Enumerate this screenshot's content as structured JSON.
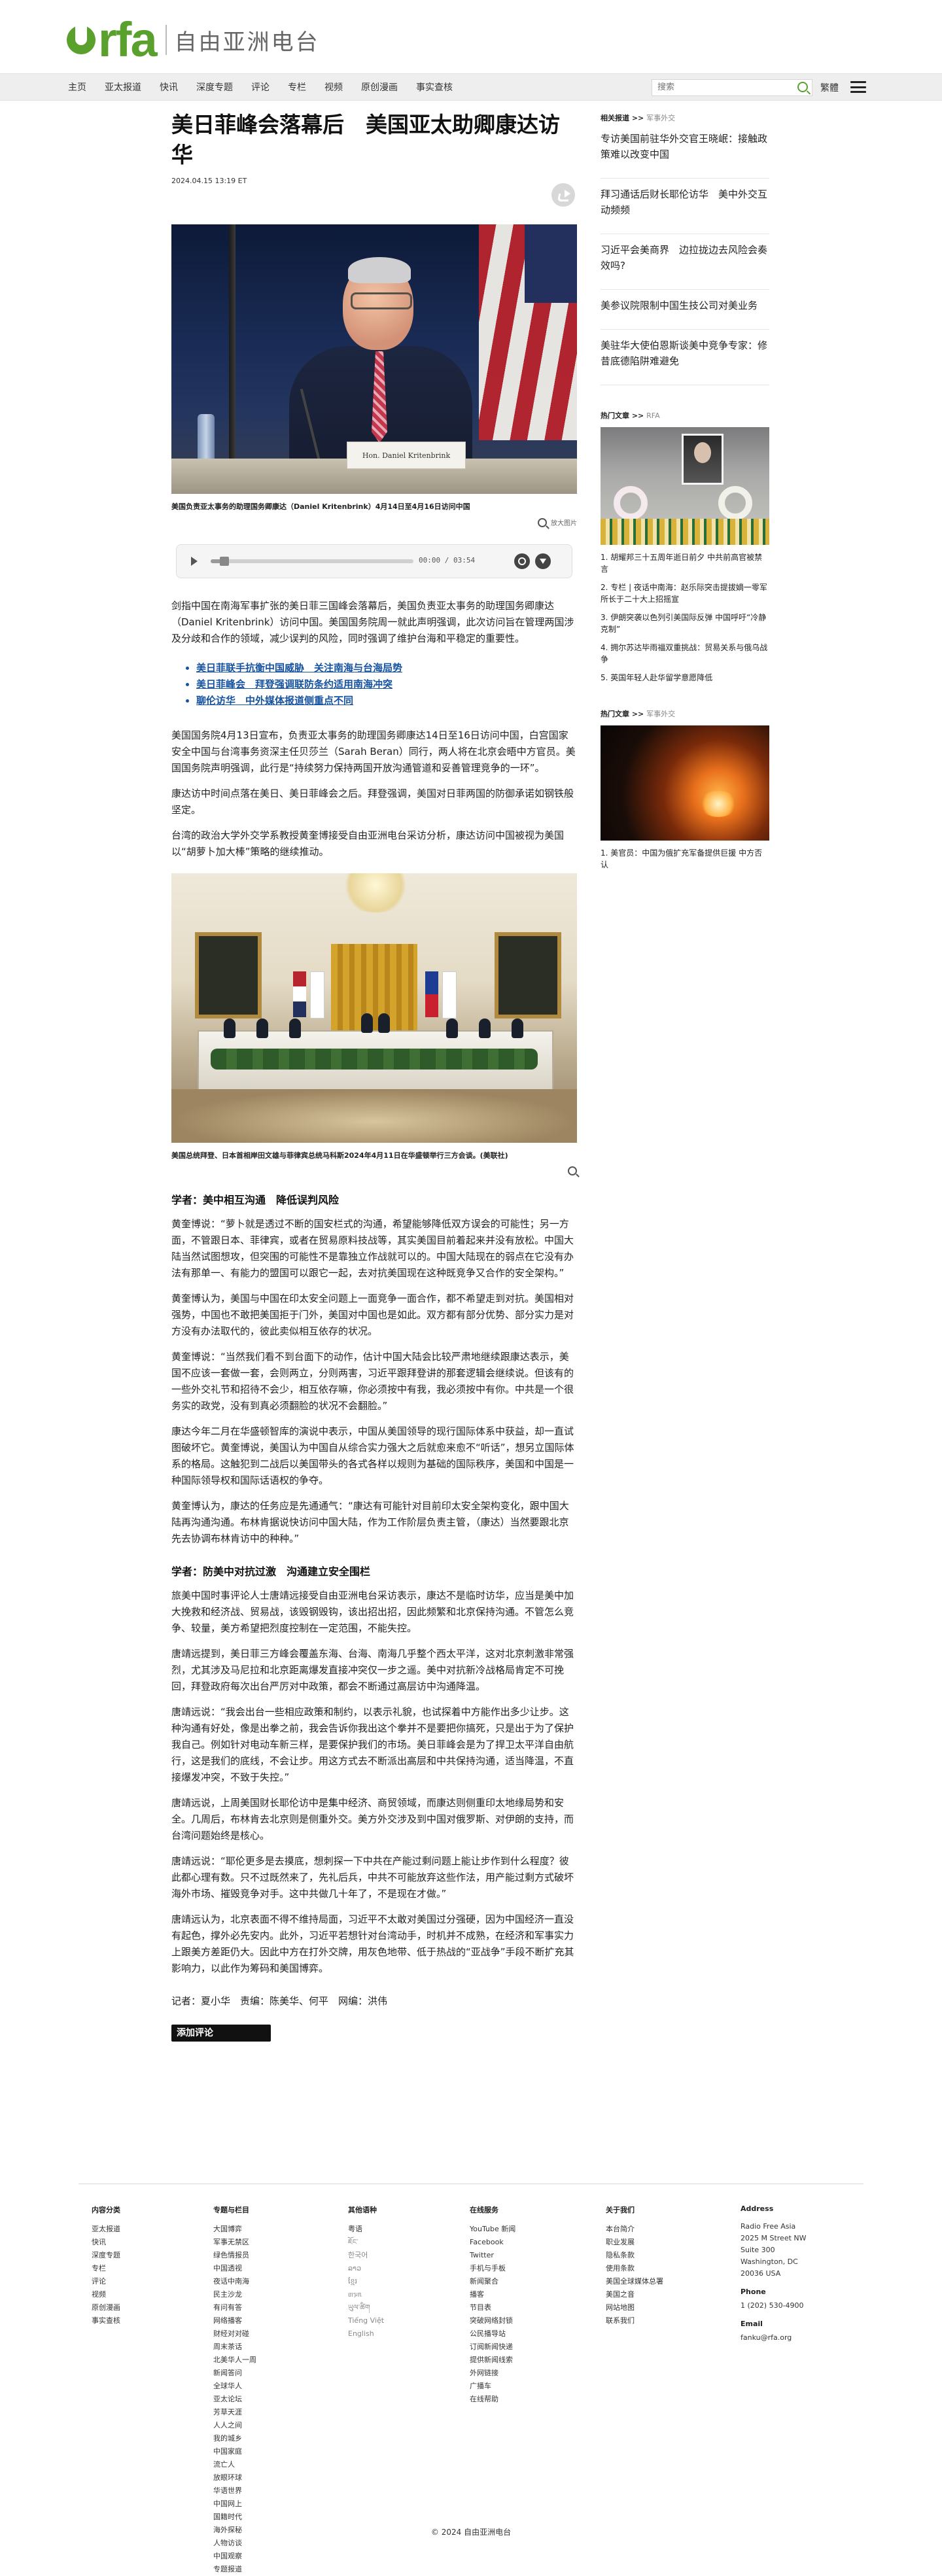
{
  "site": {
    "logo_text": "rfa",
    "name_cn": "自由亚洲电台"
  },
  "nav": {
    "items": [
      "主页",
      "亚太报道",
      "快讯",
      "深度专题",
      "评论",
      "专栏",
      "视频",
      "原创漫画",
      "事实查核"
    ],
    "search_placeholder": "搜索",
    "trad_label": "繁體"
  },
  "article": {
    "headline": "美日菲峰会落幕后　美国亚太助卿康达访华",
    "date": "2024.04.15 13:19 ET",
    "photo1": {
      "nameplate": "Hon. Daniel Kritenbrink",
      "caption": "美国负责亚太事务的助理国务卿康达（Daniel Kritenbrink）4月14日至4月16日访问中国"
    },
    "zoom_label": "放大图片",
    "audio": {
      "time": "00:00 / 03:54",
      "progress": 0.05
    },
    "lede": "剑指中国在南海军事扩张的美日菲三国峰会落幕后，美国负责亚太事务的助理国务卿康达（Daniel Kritenbrink）访问中国。美国国务院周一就此声明强调，此次访问旨在管理两国涉及分歧和合作的领域，减少误判的风险，同时强调了维护台海和平稳定的重要性。",
    "related": [
      "美日菲联手抗衡中国威胁　关注南海与台海局势",
      "美日菲峰会　拜登强调联防条约适用南海冲突",
      "聊伦访华　中外媒体报道侧重点不同"
    ],
    "paragraphs_a": [
      "美国国务院4月13日宣布，负责亚太事务的助理国务卿康达14日至16日访问中国，白宫国家安全中国与台湾事务资深主任贝莎兰（Sarah Beran）同行，两人将在北京会晤中方官员。美国国务院声明强调，此行是“持续努力保持两国开放沟通管道和妥善管理竞争的一环”。",
      "康达访中时间点落在美日、美日菲峰会之后。拜登强调，美国对日菲两国的防御承诺如钢铁般坚定。",
      "台湾的政治大学外交学系教授黄奎博接受自由亚洲电台采访分析，康达访问中国被视为美国以“胡萝卜加大棒”策略的继续推动。"
    ],
    "photo2": {
      "caption": "美国总统拜登、日本首相岸田文雄与菲律宾总统马科斯2024年4月11日在华盛顿举行三方会谈。(美联社)"
    },
    "subhead1": "学者：美中相互沟通　降低误判风险",
    "paragraphs_b": [
      "黄奎博说：“萝卜就是透过不断的国安栏式的沟通，希望能够降低双方误会的可能性；另一方面，不管跟日本、菲律宾，或者在贸易原料技战等，其实美国目前着起来并没有放松。中国大陆当然试图想攻，但突围的可能性不是靠独立作战就可以的。中国大陆现在的弱点在它没有办法有那单一、有能力的盟国可以跟它一起，去对抗美国现在这种既竞争又合作的安全架构。”",
      "黄奎博认为，美国与中国在印太安全问题上一面竞争一面合作，都不希望走到对抗。美国相对强势，中国也不敢把美国拒于门外，美国对中国也是如此。双方都有部分优势、部分实力是对方没有办法取代的，彼此卖似相互依存的状况。",
      "黄奎博说：“当然我们看不到台面下的动作，估计中国大陆会比较严肃地继续跟康达表示，美国不应该一套做一套，会则两立，分则两害，习近平跟拜登讲的那套逻辑会继续说。但该有的一些外交礼节和招待不会少，相互依存嘛，你必须按中有我，我必须按中有你。中共是一个很务实的政党，没有到真必须翻脸的状况不会翻脸。”",
      "康达今年二月在华盛顿智库的演说中表示，中国从美国领导的现行国际体系中获益，却一直试图破坏它。黄奎博说，美国认为中国自从综合实力强大之后就愈来愈不“听话”，想另立国际体系的格局。这触犯到二战后以美国带头的各式各样以规则为基础的国际秩序，美国和中国是一种国际领导权和国际话语权的争夺。",
      "黄奎博认为，康达的任务应是先通通气：“康达有可能针对目前印太安全架构变化，跟中国大陆再沟通沟通。布林肯据说快访问中国大陆，作为工作阶层负责主管，（康达）当然要跟北京先去协调布林肯访中的种种。”"
    ],
    "subhead2": "学者：防美中对抗过激　沟通建立安全围栏",
    "paragraphs_c": [
      "旅美中国时事评论人士唐靖远接受自由亚洲电台采访表示，康达不是临时访华，应当是美中加大挽救和经济战、贸易战，该毁钢毁钩，该出招出招，因此频繁和北京保持沟通。不管怎么竞争、较量，美方希望把烈度控制在一定范围，不能失控。",
      "唐靖远提到，美日菲三方峰会覆盖东海、台海、南海几乎整个西太平洋，这对北京刺激非常强烈，尤其涉及马尼拉和北京距离爆发直接冲突仅一步之遥。美中对抗新冷战格局肯定不可挽回，拜登政府每次出台严厉对中政策，都会不断通过高层访中沟通降温。",
      "唐靖远说：“我会出台一些相应政策和制约，以表示礼貌，也试探着中方能作出多少让步。这种沟通有好处，像是出拳之前，我会告诉你我出这个拳并不是要把你搞死，只是出于为了保护我自己。例如针对电动车新三样，是要保护我们的市场。美日菲峰会是为了捍卫太平洋自由航行，这是我们的底线，不会让步。用这方式去不断派出高层和中共保持沟通，适当降温，不直接爆发冲突，不致于失控。”",
      "唐靖远说，上周美国财长耶伦访中是集中经济、商贸领域，而康达则侧重印太地缘局势和安全。几周后，布林肯去北京则是侧重外交。美方外交涉及到中国对俄罗斯、对伊朗的支持，而台湾问题始终是核心。",
      "唐靖远说：“耶伦更多是去摸底，想刺探一下中共在产能过剩问题上能让步作到什么程度？彼此都心理有数。只不过既然来了，先礼后兵，中共不可能放弃这些作法，用产能过剩方式破坏海外市场、摧毁竞争对手。这中共做几十年了，不是现在才做。”",
      "唐靖远认为，北京表面不得不维持局面，习近平不太敢对美国过分强硬，因为中国经济一直没有起色，撑外必先安内。此外，习近平若想针对台湾动手，时机并不成熟，在经济和军事实力上跟美方差距仍大。因此中方在打外交牌，用灰色地带、低于热战的“亚战争”手段不断扩充其影响力，以此作为筹码和美国博弈。"
    ],
    "credits": "记者：夏小华　责编：陈美华、何平　网编：洪伟",
    "comment_button": "添加评论"
  },
  "sidebar": {
    "related": {
      "label": "相关报道",
      "category": "军事外交",
      "stories": [
        "专访美国前驻华外交官王晓岷：接触政策难以改变中国",
        "拜习通话后财长耶伦访华　美中外交互动频频",
        "习近平会美商界　边拉拢边去风险会奏效吗?",
        "美参议院限制中国生技公司对美业务",
        "美驻华大使伯恩斯谈美中竞争专家：修昔底德陷阱难避免"
      ]
    },
    "hot1": {
      "label": "热门文章",
      "category": "RFA",
      "items": [
        "1. 胡耀邦三十五周年逝日前夕 中共前高官被禁言",
        "2. 专栏 | 夜话中南海：赵乐际突击提拔嫡一零军所长于二十大上招摇宣",
        "3. 伊朗突袭以色列引美国际反弹 中国呼吁“冷静克制”",
        "4. 拥尔苏达毕雨福双重挑战：贸易关系与俄乌战争",
        "5. 英国年轻人赴华留学意愿降低"
      ]
    },
    "hot2": {
      "label": "热门文章",
      "category": "军事外交",
      "items": [
        "1. 美官员：中国为俄扩充军备提供巨援 中方否认"
      ]
    }
  },
  "footer": {
    "columns": [
      {
        "title": "内容分类",
        "items": [
          "亚太报道",
          "快讯",
          "深度专题",
          "专栏",
          "评论",
          "视频",
          "原创漫画",
          "事实查核"
        ]
      },
      {
        "title": "专题与栏目",
        "items": [
          "大国博弈",
          "军事无禁区",
          "绿色情报员",
          "中国透视",
          "夜话中南海",
          "民主沙龙",
          "有问有答",
          "网络播客",
          "财经对对碰",
          "周末茶话",
          "北美华人一周",
          "新闻答问",
          "全球华人",
          "亚太论坛",
          "芳草天涯",
          "人人之间",
          "我的城乡",
          "中国家庭",
          "流亡人",
          "放眼环球",
          "华语世界",
          "中国网上",
          "国籍时代",
          "海外探秘",
          "人物访谈",
          "中国观察",
          "专题报道"
        ]
      },
      {
        "title": "其他语种",
        "items": [
          "粤语",
          "ཇོང་",
          "한국어",
          "ລາວ",
          "ខ្មែរ",
          "ᥖᥭᥰ",
          "ཡུལ་ཚིག",
          "Tiếng Việt",
          "English"
        ]
      },
      {
        "title": "在线服务",
        "items": [
          "YouTube 新闻",
          "Facebook",
          "Twitter",
          "手机与手板",
          "新闻聚合",
          "播客",
          "节目表",
          "突破网络封锁",
          "公民播导站",
          "订阅新闻快递",
          "提供新闻线索",
          "外网链接",
          "广播车",
          "在线帮助"
        ]
      },
      {
        "title": "关于我们",
        "items": [
          "本台简介",
          "职业发展",
          "隐私条款",
          "使用条款",
          "美国全球媒体总署",
          "美国之音",
          "网站地图",
          "联系我们"
        ]
      }
    ],
    "address": {
      "title": "Address",
      "lines": [
        "Radio Free Asia",
        "2025 M Street NW",
        "Suite 300",
        "Washington, DC",
        "20036 USA"
      ],
      "phone_title": "Phone",
      "phone": "1 (202) 530-4900",
      "email_title": "Email",
      "email": "fanku@rfa.org"
    },
    "copyright": "© 2024 自由亚洲电台"
  },
  "colors": {
    "brand_green": "#5aa02c",
    "link_blue": "#1552a0",
    "nav_bg": "#eeeeee"
  }
}
